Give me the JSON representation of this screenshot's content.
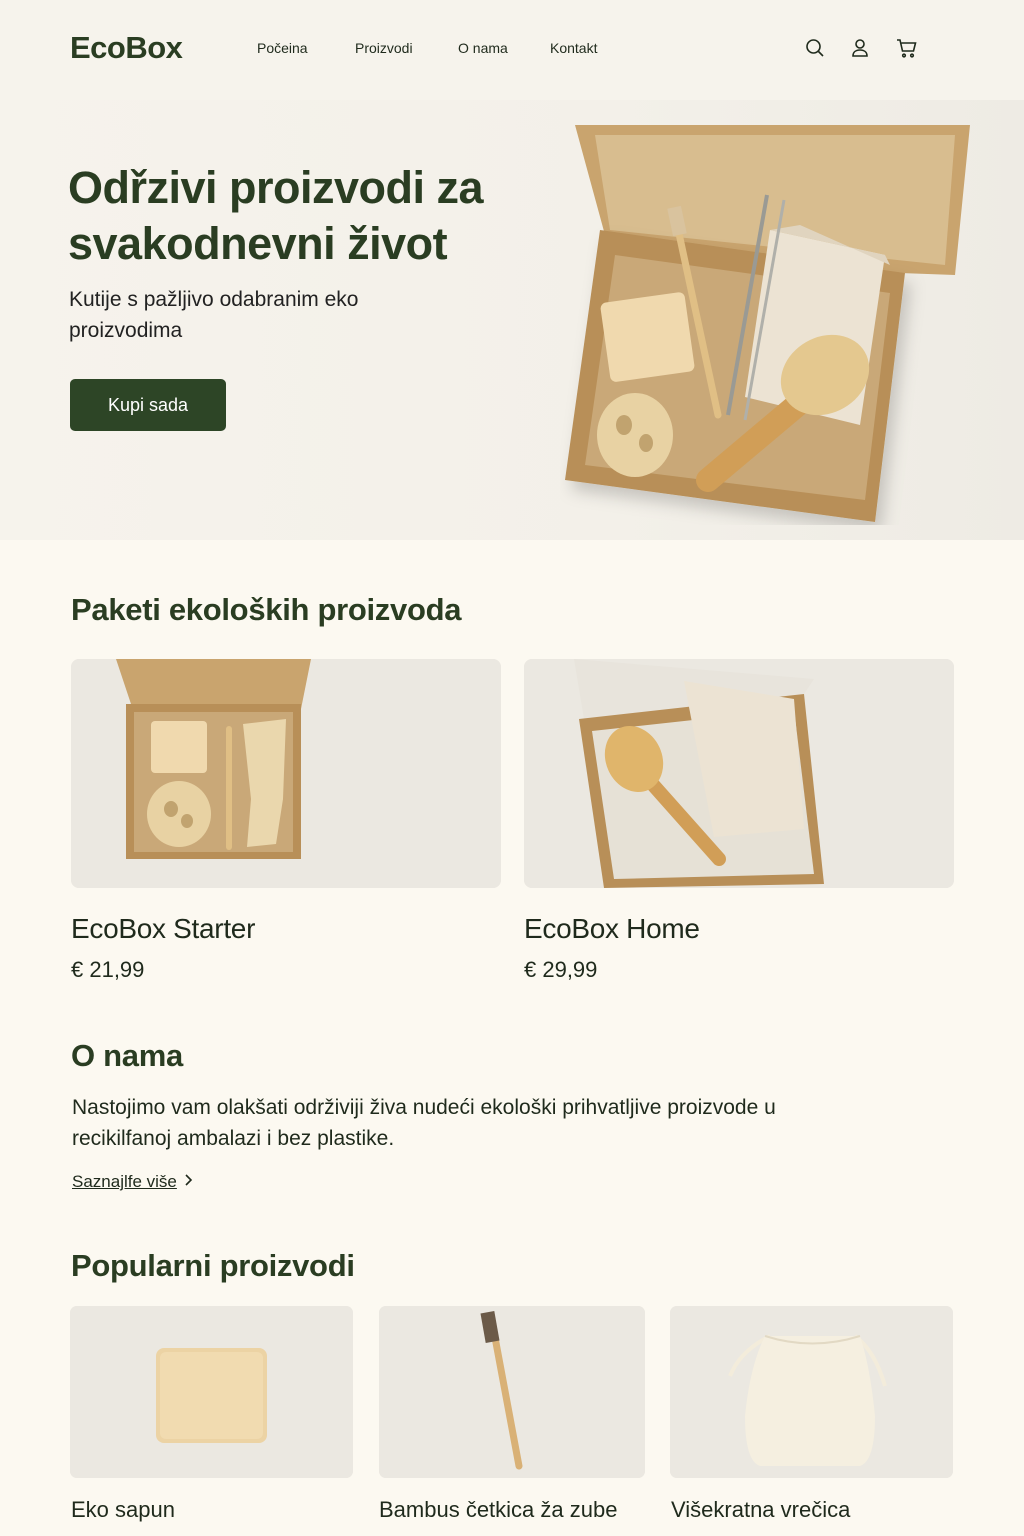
{
  "header": {
    "logo": "EcoBox",
    "nav": [
      "Počeina",
      "Proizvodi",
      "O nama",
      "Kontakt"
    ],
    "icons": [
      "search-icon",
      "user-icon",
      "cart-icon"
    ]
  },
  "hero": {
    "title": "Odřzivi proizvodi za svakodnevni život",
    "subtitle": "Kutije s pažljivo odabranim eko proizvodima",
    "cta": "Kupi sada"
  },
  "bundles": {
    "title": "Paketi ekoloških proizvoda",
    "items": [
      {
        "name": "EcoBox Starter",
        "price": "€ 21,99"
      },
      {
        "name": "EcoBox Home",
        "price": "€ 29,99"
      }
    ]
  },
  "about": {
    "title": "O nama",
    "text": "Nastojimo vam olakšati održiviji živa nudeći ekološki prihvatljive proizvode u recikilfanoj ambalazi i bez plastike.",
    "link": "Saznajlfe više"
  },
  "popular": {
    "title": "Popularni proizvodi",
    "items": [
      {
        "name": "Eko sapun"
      },
      {
        "name": "Bambus četkica ža zube"
      },
      {
        "name": "Višekratna vrečica"
      }
    ]
  },
  "colors": {
    "brand": "#2a3d22",
    "button": "#2d4526",
    "background": "#fcf9f1",
    "kraft": "#c9a46e"
  }
}
